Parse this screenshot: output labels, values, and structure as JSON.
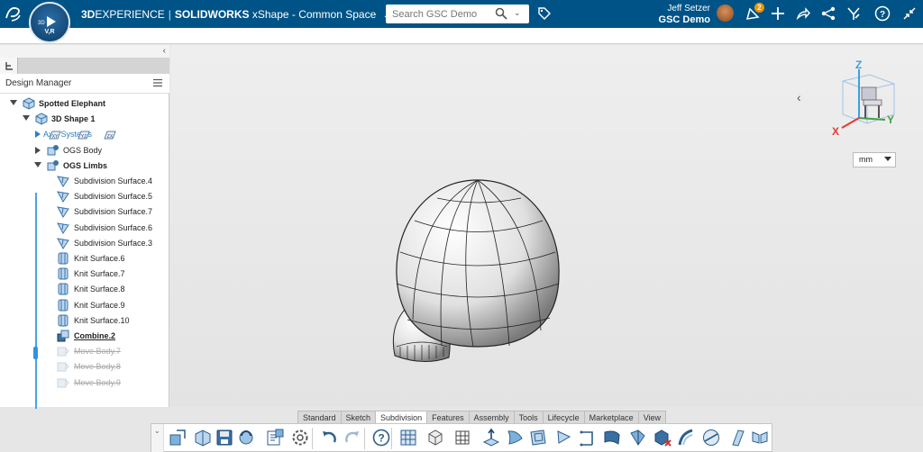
{
  "topbar": {
    "brand_prefix": "3D",
    "brand_experience": "EXPERIENCE",
    "brand_app": "SOLIDWORKS",
    "app_name": "xShape - Common Space",
    "compass_label": "V,R",
    "compass_3d": "3D",
    "search_placeholder": "Search GSC Demo",
    "user_name": "Jeff Setzer",
    "company": "GSC Demo",
    "notification_count": "2",
    "brand_color": "#005386",
    "badge_color": "#f39200"
  },
  "panel": {
    "title": "Design Manager"
  },
  "tree": [
    {
      "label": "Spotted Elephant",
      "style": "bold",
      "arrow": "down",
      "indent": 0,
      "icon": "part-icon"
    },
    {
      "label": "3D Shape 1",
      "style": "bold",
      "arrow": "down",
      "indent": 1,
      "icon": "shape-icon"
    },
    {
      "label": "Axis Systems",
      "style": "blue",
      "arrow": "right-blue",
      "indent": 2,
      "icon": ""
    },
    {
      "label": "OGS Body",
      "style": "normal",
      "arrow": "right",
      "indent": 2,
      "icon": "body-icon"
    },
    {
      "label": "OGS Limbs",
      "style": "bold",
      "arrow": "down",
      "indent": 2,
      "icon": "body-icon"
    },
    {
      "label": "Subdivision Surface.4",
      "style": "normal",
      "indent": 3,
      "icon": "subdivision-icon"
    },
    {
      "label": "Subdivision Surface.5",
      "style": "normal",
      "indent": 3,
      "icon": "subdivision-icon"
    },
    {
      "label": "Subdivision Surface.7",
      "style": "normal",
      "indent": 3,
      "icon": "subdivision-icon"
    },
    {
      "label": "Subdivision Surface.6",
      "style": "normal",
      "indent": 3,
      "icon": "subdivision-icon"
    },
    {
      "label": "Subdivision Surface.3",
      "style": "normal",
      "indent": 3,
      "icon": "subdivision-icon"
    },
    {
      "label": "Knit Surface.6",
      "style": "normal",
      "indent": 3,
      "icon": "knit-icon"
    },
    {
      "label": "Knit Surface.7",
      "style": "normal",
      "indent": 3,
      "icon": "knit-icon"
    },
    {
      "label": "Knit Surface.8",
      "style": "normal",
      "indent": 3,
      "icon": "knit-icon"
    },
    {
      "label": "Knit Surface.9",
      "style": "normal",
      "indent": 3,
      "icon": "knit-icon"
    },
    {
      "label": "Knit Surface.10",
      "style": "normal",
      "indent": 3,
      "icon": "knit-icon"
    },
    {
      "label": "Combine.2",
      "style": "underline",
      "indent": 3,
      "icon": "combine-icon"
    },
    {
      "label": "Move Body.7",
      "style": "struck",
      "indent": 3,
      "icon": "move-icon"
    },
    {
      "label": "Move Body.8",
      "style": "struck",
      "indent": 3,
      "icon": "move-icon"
    },
    {
      "label": "Move Body.9",
      "style": "struck",
      "indent": 3,
      "icon": "move-icon"
    }
  ],
  "viewport": {
    "units": "mm",
    "axis_z": "Z",
    "axis_x": "X",
    "axis_y": "Y"
  },
  "action_tabs": [
    "Standard",
    "Sketch",
    "Subdivision",
    "Features",
    "Assembly",
    "Tools",
    "Lifecycle",
    "Marketplace",
    "View"
  ],
  "active_tab": "Subdivision",
  "action_icons": [
    "new-component-icon",
    "open-icon",
    "save-icon",
    "refresh-icon",
    "properties-icon",
    "settings-icon",
    "undo-icon",
    "redo-icon",
    "help-icon",
    "mesh-grid-icon",
    "box-icon",
    "subdivide-grid-icon",
    "extrude-icon",
    "face-icon",
    "plane-icon",
    "flag-icon",
    "split-icon",
    "bend-icon",
    "crease-icon",
    "delete-box-icon",
    "arc-icon",
    "sphere-icon",
    "strip-icon",
    "symmetry-icon"
  ]
}
